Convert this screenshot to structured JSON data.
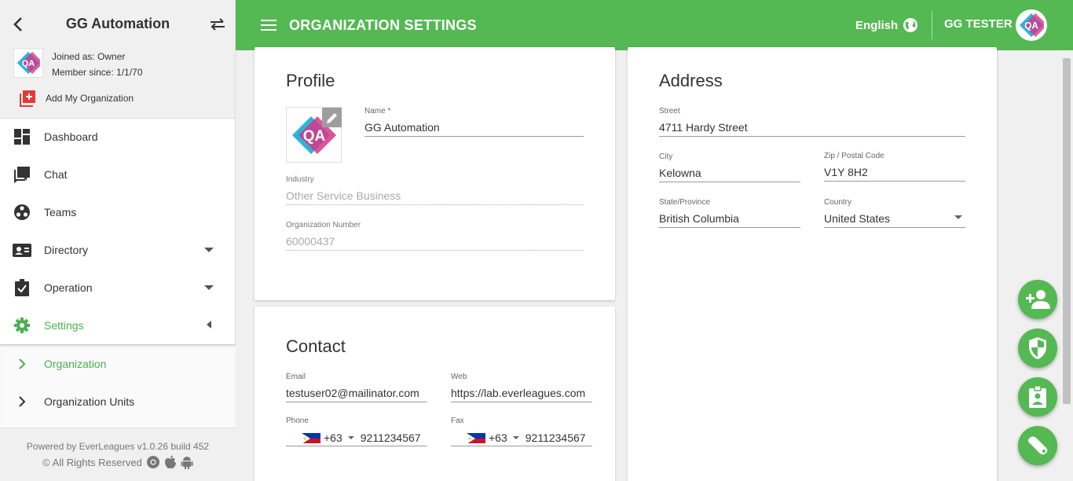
{
  "sidebar": {
    "org_name": "GG Automation",
    "joined_as": "Joined as: Owner",
    "member_since": "Member since: 1/1/70",
    "add_org_label": "Add My Organization",
    "nav": [
      {
        "label": "Dashboard",
        "icon": "dashboard-icon"
      },
      {
        "label": "Chat",
        "icon": "chat-icon"
      },
      {
        "label": "Teams",
        "icon": "teams-icon"
      },
      {
        "label": "Directory",
        "icon": "contact-card-icon"
      },
      {
        "label": "Operation",
        "icon": "clipboard-check-icon"
      },
      {
        "label": "Settings",
        "icon": "gear-icon"
      }
    ],
    "sub_nav": [
      {
        "label": "Organization"
      },
      {
        "label": "Organization Units"
      }
    ],
    "footer_line1": "Powered by EverLeagues v1.0.26 build 452",
    "footer_line2": "© All Rights Reserved"
  },
  "topbar": {
    "title": "ORGANIZATION SETTINGS",
    "language": "English",
    "user_name": "GG TESTER"
  },
  "profile": {
    "title": "Profile",
    "name_label": "Name *",
    "name_value": "GG Automation",
    "industry_label": "Industry",
    "industry_value": "Other Service Business",
    "org_number_label": "Organization Number",
    "org_number_value": "60000437"
  },
  "contact": {
    "title": "Contact",
    "email_label": "Email",
    "email_value": "testuser02@mailinator.com",
    "web_label": "Web",
    "web_value": "https://lab.everleagues.com",
    "phone_label": "Phone",
    "phone_code": "+63",
    "phone_value": "9211234567",
    "fax_label": "Fax",
    "fax_code": "+63",
    "fax_value": "9211234567"
  },
  "address": {
    "title": "Address",
    "street_label": "Street",
    "street_value": "4711 Hardy Street",
    "city_label": "City",
    "city_value": "Kelowna",
    "zip_label": "Zip / Postal Code",
    "zip_value": "V1Y 8H2",
    "state_label": "State/Province",
    "state_value": "British Columbia",
    "country_label": "Country",
    "country_value": "United States"
  },
  "colors": {
    "accent": "#54b853",
    "active_text": "#4caf50"
  },
  "fabs": [
    "add-user-icon",
    "shield-icon",
    "badge-icon",
    "wrench-icon"
  ]
}
